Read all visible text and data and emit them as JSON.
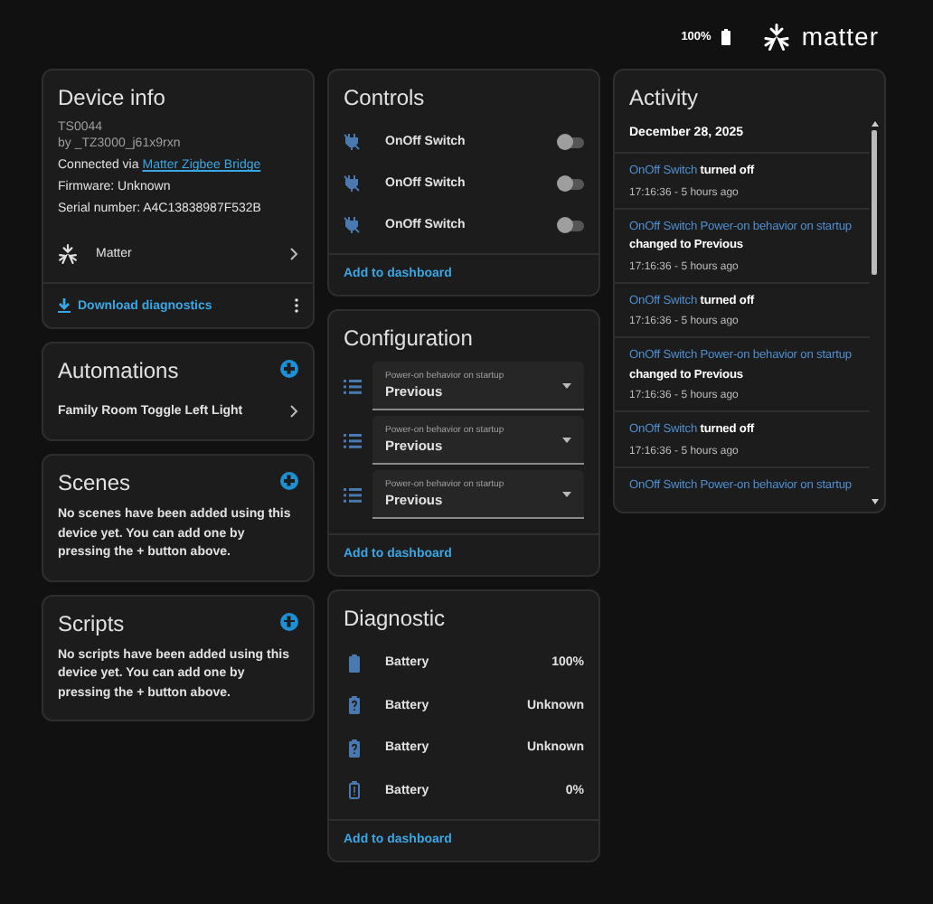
{
  "header": {
    "battery": "100%",
    "brand": "matter"
  },
  "device_info": {
    "title": "Device info",
    "model": "TS0044",
    "manufacturer": "by _TZ3000_j61x9rxn",
    "connected_label": "Connected via",
    "connected_link": "Matter Zigbee Bridge",
    "firmware": "Firmware: Unknown",
    "serial": "Serial number: A4C13838987F532B",
    "integration": "Matter",
    "action": "Download diagnostics"
  },
  "automations": {
    "title": "Automations",
    "items": [
      "Family Room Toggle Left Light"
    ]
  },
  "scenes": {
    "title": "Scenes",
    "text": "No scenes have been added using this device yet. You can add one by pressing the + button above."
  },
  "scripts": {
    "title": "Scripts",
    "text": "No scripts have been added using this device yet. You can add one by pressing the + button above."
  },
  "controls": {
    "title": "Controls",
    "items": [
      {
        "name": "OnOff Switch",
        "on": false
      },
      {
        "name": "OnOff Switch",
        "on": false
      },
      {
        "name": "OnOff Switch",
        "on": false
      }
    ],
    "action": "Add to dashboard"
  },
  "configuration": {
    "title": "Configuration",
    "items": [
      {
        "label": "Power-on behavior on startup",
        "value": "Previous"
      },
      {
        "label": "Power-on behavior on startup",
        "value": "Previous"
      },
      {
        "label": "Power-on behavior on startup",
        "value": "Previous"
      }
    ],
    "action": "Add to dashboard"
  },
  "diagnostic": {
    "title": "Diagnostic",
    "items": [
      {
        "kind": "full",
        "name": "Battery",
        "value": "100%"
      },
      {
        "kind": "unknown",
        "name": "Battery",
        "value": "Unknown"
      },
      {
        "kind": "unknown",
        "name": "Battery",
        "value": "Unknown"
      },
      {
        "kind": "empty",
        "name": "Battery",
        "value": "0%"
      }
    ],
    "action": "Add to dashboard"
  },
  "activity": {
    "title": "Activity",
    "date": "December 28, 2025",
    "entries": [
      {
        "entity": "OnOff Switch",
        "message": "turned off",
        "time": "17:16:36 - 5 hours ago"
      },
      {
        "entity": "OnOff Switch Power-on behavior on startup",
        "message": "changed to Previous",
        "time": "17:16:36 - 5 hours ago"
      },
      {
        "entity": "OnOff Switch",
        "message": "turned off",
        "time": "17:16:36 - 5 hours ago"
      },
      {
        "entity": "OnOff Switch Power-on behavior on startup",
        "message": "changed to Previous",
        "time": "17:16:36 - 5 hours ago"
      },
      {
        "entity": "OnOff Switch",
        "message": "turned off",
        "time": "17:16:36 - 5 hours ago"
      },
      {
        "entity": "OnOff Switch Power-on behavior on startup"
      }
    ]
  }
}
